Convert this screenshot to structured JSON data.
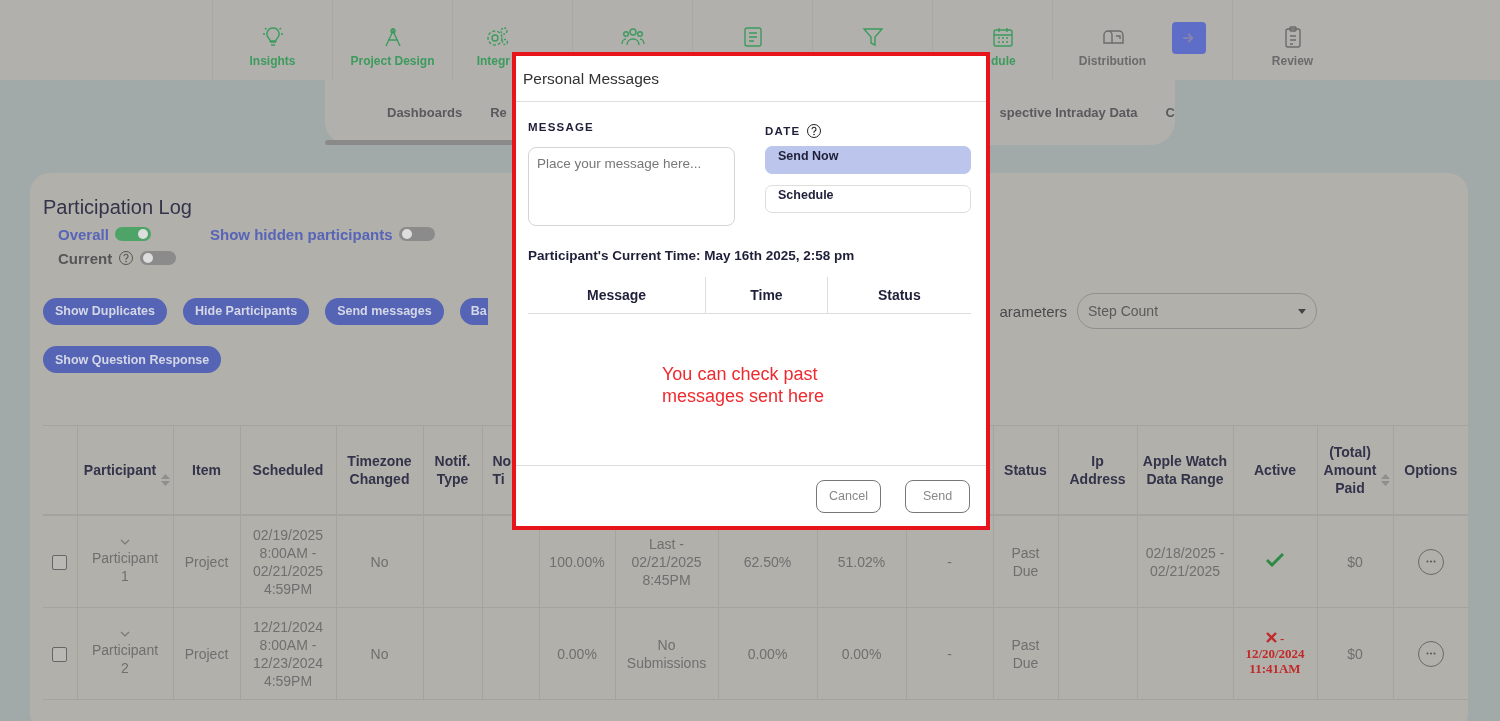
{
  "top_nav": {
    "items": [
      {
        "kind": "step",
        "label": "Insights",
        "done": true
      },
      {
        "kind": "step",
        "label": "Project Design",
        "done": true
      },
      {
        "kind": "step",
        "label": "Integr",
        "done": true
      },
      {
        "kind": "step",
        "done": true
      },
      {
        "kind": "step",
        "done": true
      },
      {
        "kind": "step",
        "done": true
      },
      {
        "kind": "step",
        "label": "dule",
        "done": true
      },
      {
        "kind": "step",
        "label": "Distribution",
        "done": false
      },
      {
        "kind": "action"
      },
      {
        "kind": "step",
        "label": "Review",
        "done": false
      }
    ]
  },
  "sub_nav": {
    "left": [
      {
        "label": "Dashboards"
      },
      {
        "label": "Re"
      }
    ],
    "right": [
      {
        "label": "spective Intraday Data"
      },
      {
        "label": "C"
      }
    ]
  },
  "participation_log": {
    "title": "Participation Log",
    "toggles": [
      {
        "label": "Overall",
        "on": true,
        "help": false
      },
      {
        "label": "Current",
        "on": false,
        "help": true
      },
      {
        "label": "Show hidden participants",
        "on": false,
        "help": false
      }
    ],
    "buttons": [
      {
        "label": "Show Duplicates"
      },
      {
        "label": "Hide Participants"
      },
      {
        "label": "Send messages"
      },
      {
        "label": "Ba"
      },
      {
        "label": "Show Question Response"
      }
    ],
    "parameters_label": "arameters",
    "parameters_select": {
      "value": "Step Count"
    },
    "table": {
      "columns": [
        null,
        {
          "label": "Participant",
          "sortable": true
        },
        {
          "label": "Item",
          "sortable": false
        },
        {
          "label": "Scheduled",
          "sortable": false
        },
        {
          "label": "Timezone Changed",
          "sortable": false
        },
        {
          "label": "Notif. Type",
          "sortable": false
        },
        {
          "label": "No Ti",
          "sortable": false
        },
        null,
        null,
        null,
        null,
        null,
        {
          "label": "Status",
          "sortable": false
        },
        {
          "label": "Ip Address",
          "sortable": false
        },
        {
          "label": "Apple Watch Data Range",
          "sortable": false
        },
        {
          "label": "Active",
          "sortable": false
        },
        {
          "label": "(Total) Amount Paid",
          "sortable": true
        },
        {
          "label": "Options",
          "sortable": false
        }
      ],
      "rows": [
        {
          "checked": false,
          "cells": [
            null,
            "Participant 1",
            "Project",
            "02/19/2025 8:00AM - 02/21/2025 4:59PM",
            "No",
            null,
            null,
            "100.00%",
            "Last - 02/21/2025 8:45PM",
            "62.50%",
            "51.02%",
            "-",
            "Past Due",
            null,
            "02/18/2025 - 02/21/2025",
            null,
            "$0",
            null
          ],
          "active": true
        },
        {
          "checked": false,
          "cells": [
            null,
            "Participant 2",
            "Project",
            "12/21/2024 8:00AM - 12/23/2024 4:59PM",
            "No",
            null,
            null,
            "0.00%",
            "No Submissions",
            "0.00%",
            "0.00%",
            "-",
            "Past Due",
            null,
            null,
            null,
            "$0",
            null
          ],
          "active": false,
          "inactive_note": "- 12/20/2024 11:41AM"
        }
      ]
    }
  },
  "modal": {
    "title": "Personal Messages",
    "message_label": "MESSAGE",
    "message_placeholder": "Place your message here...",
    "date_label": "DATE",
    "date_options": [
      {
        "label": "Send Now",
        "selected": true
      },
      {
        "label": "Schedule",
        "selected": false
      }
    ],
    "current_time": "Participant's Current Time: May 16th 2025, 2:58 pm",
    "columns": [
      "Message",
      "Time",
      "Status"
    ],
    "annotation": "You can check past messages sent here",
    "buttons": [
      "Cancel",
      "Send"
    ]
  }
}
